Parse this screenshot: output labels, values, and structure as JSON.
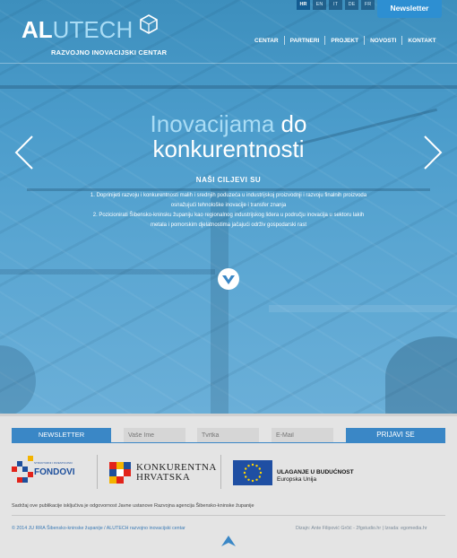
{
  "header": {
    "logo": {
      "main_al": "AL",
      "main_tech": "UTECH",
      "subtitle": "RAZVOJNO INOVACIJSKI CENTAR"
    },
    "languages": [
      {
        "code": "HR",
        "active": true
      },
      {
        "code": "EN",
        "active": false
      },
      {
        "code": "IT",
        "active": false
      },
      {
        "code": "DE",
        "active": false
      },
      {
        "code": "FR",
        "active": false
      }
    ],
    "newsletter_button": "Newsletter",
    "nav": [
      "CENTAR",
      "PARTNERI",
      "PROJEKT",
      "NOVOSTI",
      "KONTAKT"
    ]
  },
  "hero": {
    "headline_accent": "Inovacijama",
    "headline_rest": " do",
    "headline_line2": "konkurentnosti",
    "goals_title": "NAŠI CILJEVI SU",
    "goal_1": "1. Doprinijeti razvoju i konkurentnosti malih i srednjih poduzeća u industrijskoj proizvodnji i razvoju finalnih proizvoda osnažujući tehnološke inovacije i transfer znanja",
    "goal_2": "2. Pozicionirati Šibensko-kninsku županiju kao regionalnog industrijskog lidera u području inovacija u sektoru lakih metala i pomorskim djelatnostima jačajući održiv gospodarski rast"
  },
  "newsletter_form": {
    "label": "NEWSLETTER",
    "name_placeholder": "Vaše Ime",
    "company_placeholder": "Tvrtka",
    "email_placeholder": "E-Mail",
    "submit": "PRIJAVI SE"
  },
  "sponsors": {
    "fondovi_small": "STRUKTURNI I INVESTICIJSKI",
    "fondovi_big": "FONDOVI",
    "kh_line1": "KONKURENTNA",
    "kh_line2": "HRVATSKA",
    "eu_line1": "ULAGANJE U BUDUĆNOST",
    "eu_line2": "Europska Unija"
  },
  "footer": {
    "disclaimer": "Sadržaj ove publikacije isključiva je odgovornost Javne ustanove Razvojna agencija Šibensko-kninske županije",
    "copyright": "© 2014 JU RRA Šibensko-kninske županije / ALUTECH razvojno inovacijski centar",
    "credits_design": "Dizajn: Ante Filipović Grčić - 2fgstudio.hr",
    "credits_sep": " | ",
    "credits_build": "Izrada: egomedia.hr"
  },
  "colors": {
    "accent_blue": "#3a87c6",
    "hero_blue": "#4b9ccb",
    "headline_accent": "#a9dcf5"
  },
  "icons": [
    "hexagon-cube-icon",
    "chevron-left-icon",
    "chevron-right-icon",
    "chevron-down-icon",
    "arrow-up-icon",
    "eu-flag-icon"
  ]
}
